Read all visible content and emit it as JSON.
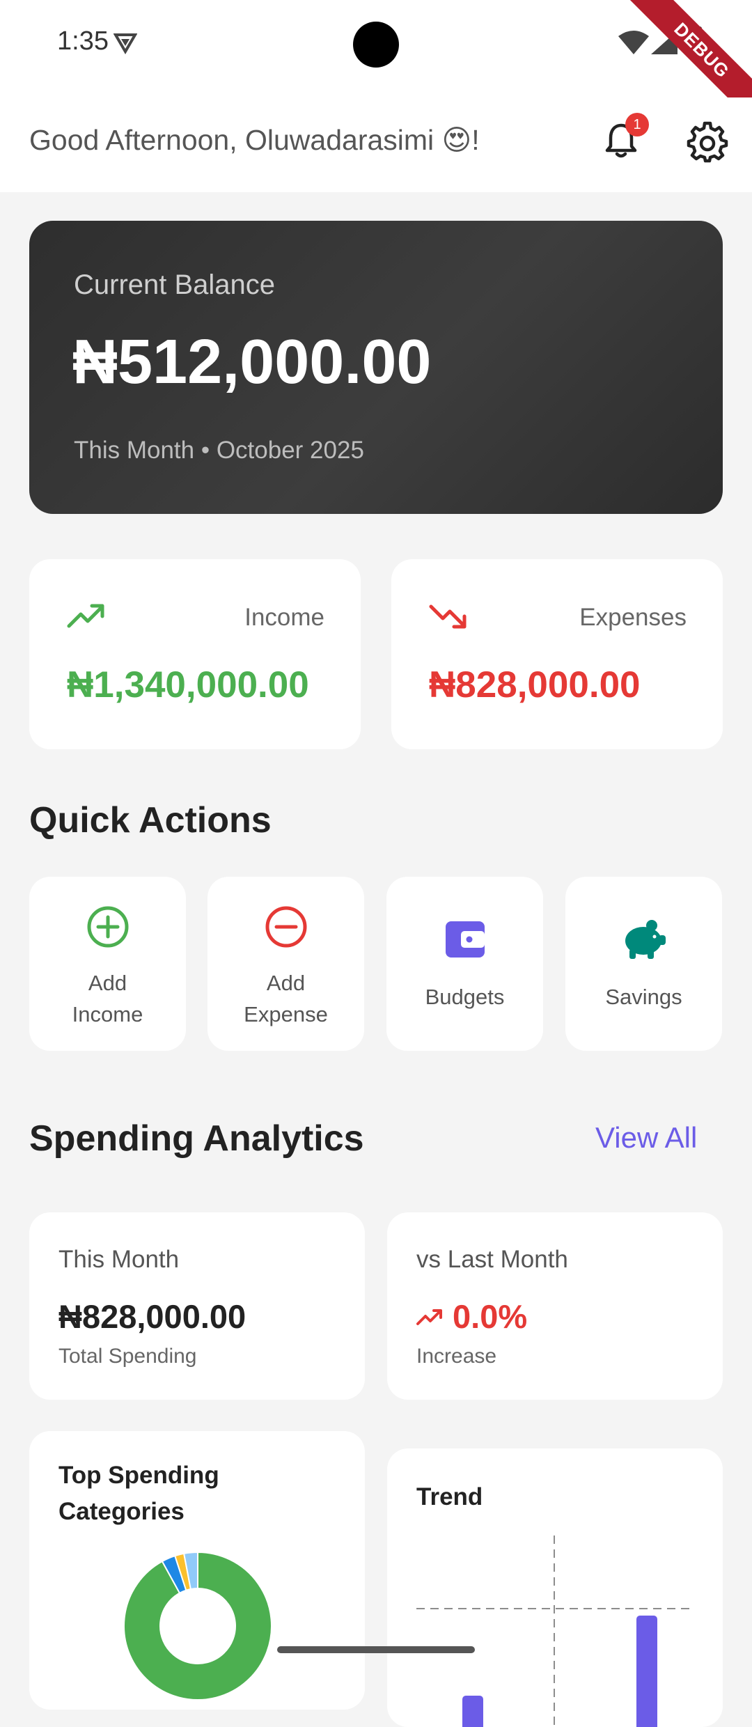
{
  "status_bar": {
    "time": "1:35",
    "debug_label": "DEBUG"
  },
  "header": {
    "greeting": "Good Afternoon, Oluwadarasimi 😍!",
    "notification_count": "1",
    "icons": [
      "bell-icon",
      "gear-icon"
    ]
  },
  "balance": {
    "label": "Current Balance",
    "amount": "₦512,000.00",
    "period": "This Month • October 2025"
  },
  "income": {
    "label": "Income",
    "amount": "₦1,340,000.00",
    "color": "#4caf50"
  },
  "expenses": {
    "label": "Expenses",
    "amount": "₦828,000.00",
    "color": "#e53935"
  },
  "quick_actions": {
    "title": "Quick Actions",
    "items": [
      {
        "line1": "Add",
        "line2": "Income",
        "icon": "plus-circle-icon",
        "color": "#4caf50"
      },
      {
        "line1": "Add",
        "line2": "Expense",
        "icon": "minus-circle-icon",
        "color": "#e53935"
      },
      {
        "label": "Budgets",
        "icon": "wallet-icon",
        "color": "#6b5ce7"
      },
      {
        "label": "Savings",
        "icon": "piggy-bank-icon",
        "color": "#00897b"
      }
    ]
  },
  "analytics": {
    "title": "Spending Analytics",
    "view_all": "View All",
    "this_month": {
      "heading": "This Month",
      "value": "₦828,000.00",
      "sub": "Total Spending"
    },
    "vs_last_month": {
      "heading": "vs Last Month",
      "value": "0.0%",
      "sub": "Increase",
      "color": "#e53935"
    },
    "top_categories": {
      "title_line1": "Top Spending",
      "title_line2": "Categories"
    },
    "trend": {
      "title": "Trend"
    }
  },
  "chart_data": [
    {
      "type": "pie",
      "title": "Top Spending Categories",
      "series": [
        {
          "color": "#4caf50",
          "value": 92
        },
        {
          "color": "#1e88e5",
          "value": 3
        },
        {
          "color": "#fbc02d",
          "value": 2
        },
        {
          "color": "#90caf9",
          "value": 3
        }
      ]
    },
    {
      "type": "bar",
      "title": "Trend",
      "color": "#6b5ce7",
      "values": [
        45,
        160
      ]
    }
  ]
}
